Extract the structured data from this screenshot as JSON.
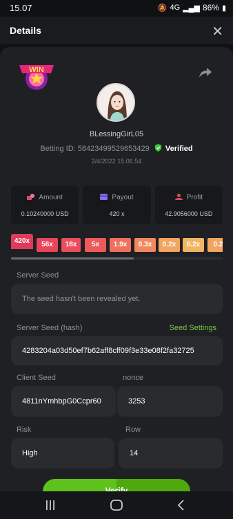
{
  "status": {
    "time": "15.07",
    "signal": "4G",
    "battery": "86%"
  },
  "header": {
    "title": "Details",
    "close_icon": "close-icon"
  },
  "user": {
    "name": "BLessingGirL05",
    "betting_id_label": "Betting ID:",
    "betting_id": "584234995296534​29",
    "verified": "Verified",
    "date": "2/4/2022 15.06.54"
  },
  "stats": {
    "amount": {
      "label": "Amount",
      "value": "0.10240000 USD"
    },
    "payout": {
      "label": "Payout",
      "value": "420 x"
    },
    "profit": {
      "label": "Profit",
      "value": "42.9056000 USD"
    }
  },
  "multipliers": [
    {
      "label": "420x",
      "color": "#e03a5a"
    },
    {
      "label": "56x",
      "color": "#e9455b"
    },
    {
      "label": "18x",
      "color": "#ea4d5c"
    },
    {
      "label": "5x",
      "color": "#ee5a5c"
    },
    {
      "label": "1.9x",
      "color": "#f0705e"
    },
    {
      "label": "0.3x",
      "color": "#f08a5e"
    },
    {
      "label": "0.2x",
      "color": "#f2a55f"
    },
    {
      "label": "0.2x",
      "color": "#f2b662"
    },
    {
      "label": "0.2",
      "color": "#f2a55f"
    }
  ],
  "fields": {
    "server_seed_label": "Server Seed",
    "server_seed_value": "The seed hasn't been revealed yet.",
    "server_seed_hash_label": "Server Seed (hash)",
    "seed_settings": "Seed Settings",
    "server_seed_hash_value": "4283204a03d50ef7b62aff8cff09f3e33e08f2fa32725",
    "client_seed_label": "Client Seed",
    "client_seed_value": "4811nYmhbpG0Ccpr60",
    "nonce_label": "nonce",
    "nonce_value": "3253",
    "risk_label": "Risk",
    "risk_value": "High",
    "row_label": "Row",
    "row_value": "14"
  },
  "verify_button": "Verify"
}
